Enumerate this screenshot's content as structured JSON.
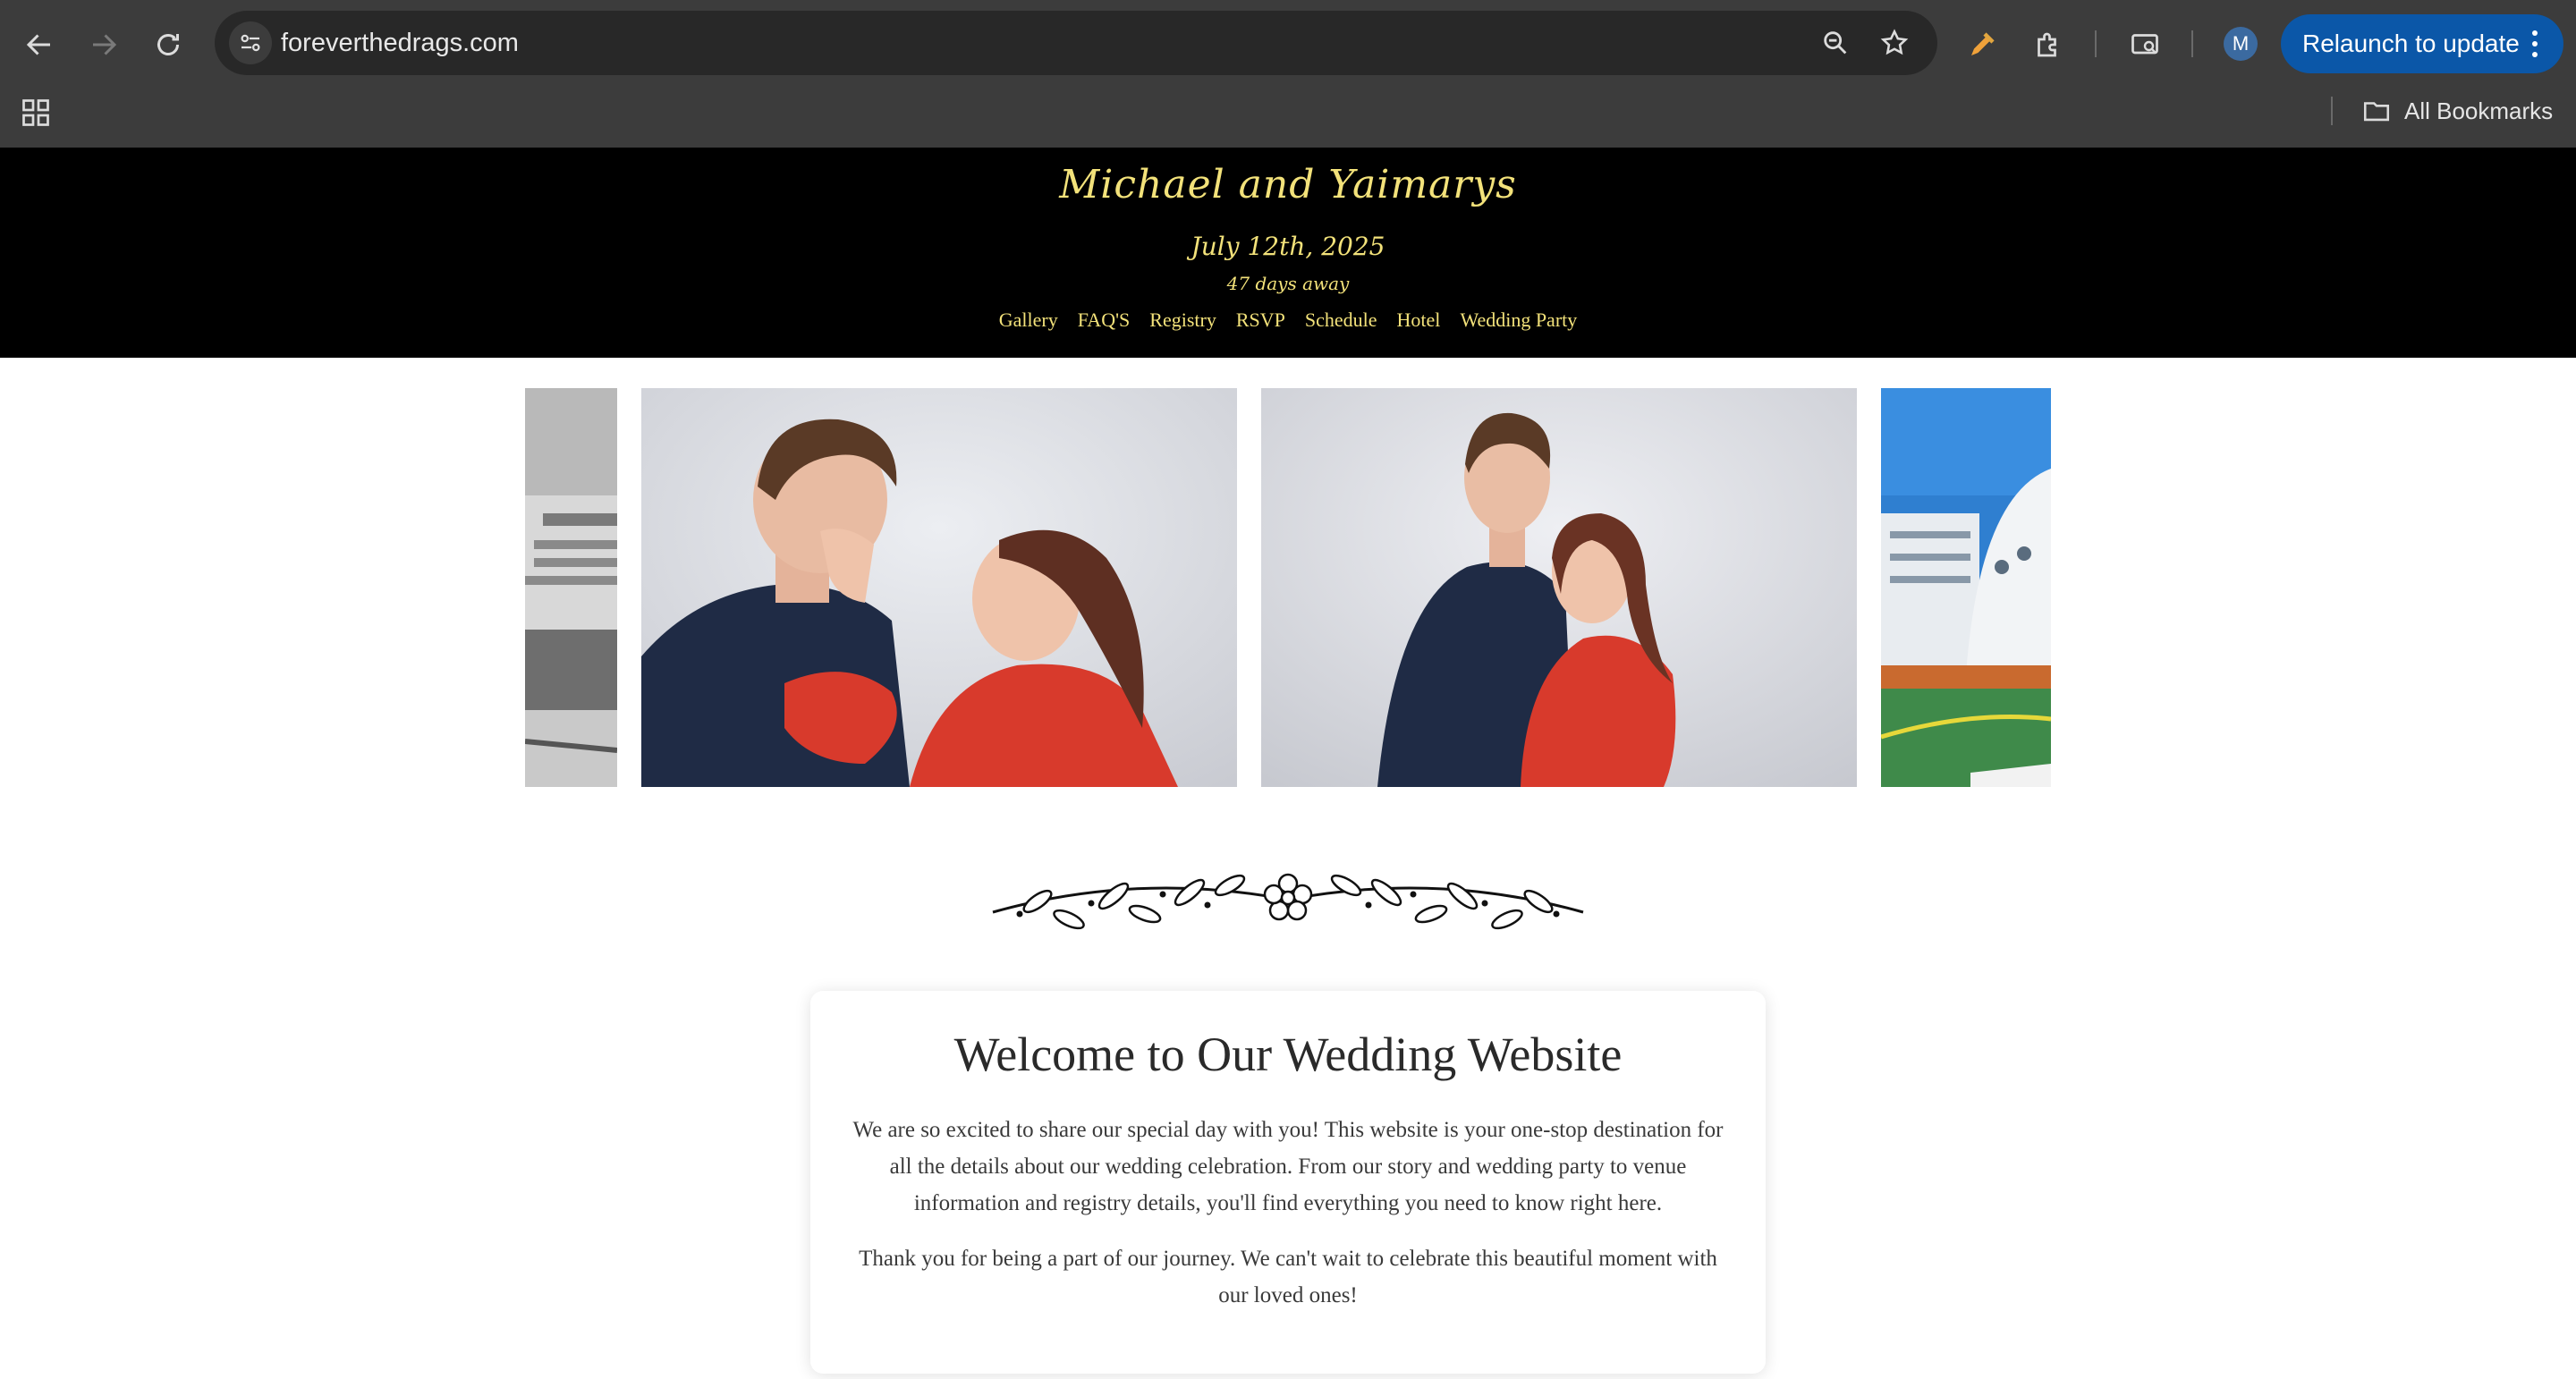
{
  "browser": {
    "url": "foreverthedrags.com",
    "avatar_letter": "M",
    "relaunch_label": "Relaunch to update",
    "bookmarks_label": "All Bookmarks",
    "icons": [
      "back-icon",
      "forward-icon",
      "reload-icon",
      "site-info-icon",
      "zoom-icon",
      "star-icon",
      "eyedropper-icon",
      "extensions-icon",
      "tab-search-icon",
      "apps-icon",
      "folder-icon",
      "more-icon"
    ]
  },
  "header": {
    "couple": "Michael and Yaimarys",
    "date": "July 12th, 2025",
    "countdown": "47 days away",
    "nav": [
      "Gallery",
      "FAQ'S",
      "Registry",
      "RSVP",
      "Schedule",
      "Hotel",
      "Wedding Party"
    ],
    "accent_color": "#f3e27a",
    "background_color": "#000000"
  },
  "welcome": {
    "title": "Welcome to Our Wedding Website",
    "paragraph1": "We are so excited to share our special day with you! This website is your one-stop destination for all the details about our wedding celebration. From our story and wedding party to venue information and registry details, you'll find everything you need to know right here.",
    "paragraph2": "Thank you for being a part of our journey. We can't wait to celebrate this beautiful moment with our loved ones!"
  }
}
